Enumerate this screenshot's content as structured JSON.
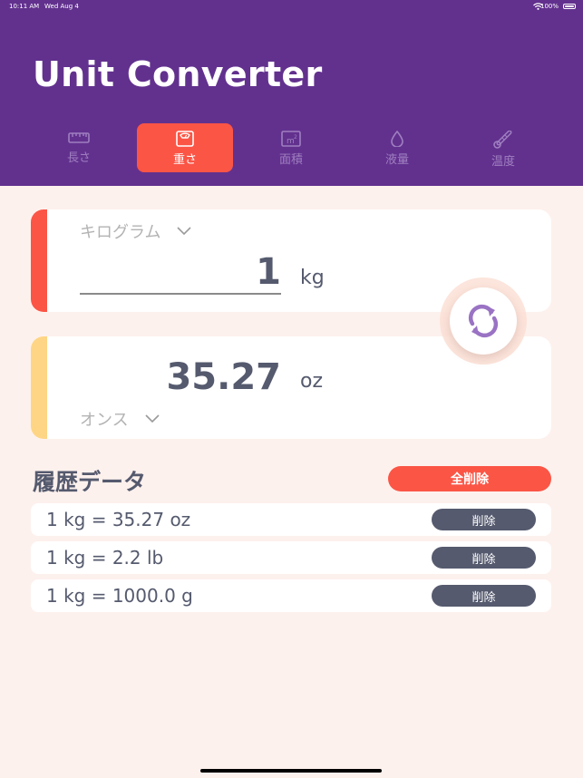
{
  "status_bar": {
    "time": "10:11 AM",
    "date": "Wed Aug 4",
    "battery": "100%"
  },
  "app": {
    "title": "Unit Converter"
  },
  "tabs": [
    {
      "label": "長さ",
      "icon": "ruler-icon",
      "active": false
    },
    {
      "label": "重さ",
      "icon": "scale-icon",
      "active": true
    },
    {
      "label": "面積",
      "icon": "area-icon",
      "active": false
    },
    {
      "label": "液量",
      "icon": "droplet-icon",
      "active": false
    },
    {
      "label": "温度",
      "icon": "thermometer-icon",
      "active": false
    }
  ],
  "from": {
    "unit_name": "キログラム",
    "value": "1",
    "unit_abbr": "kg"
  },
  "to": {
    "unit_name": "オンス",
    "value": "35.27",
    "unit_abbr": "oz"
  },
  "history": {
    "title": "履歴データ",
    "clear_all_label": "全削除",
    "delete_label": "削除",
    "items": [
      "1 kg = 35.27 oz",
      "1 kg = 2.2 lb",
      "1 kg = 1000.0 g"
    ]
  },
  "colors": {
    "header": "#62318e",
    "accent": "#fb5546",
    "secondary": "#fed585",
    "text": "#555a6e",
    "background": "#fdf1ed"
  }
}
